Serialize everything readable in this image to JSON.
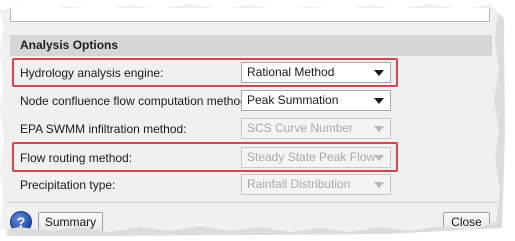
{
  "section": {
    "title": "Analysis Options"
  },
  "rows": [
    {
      "label": "Hydrology analysis engine:",
      "value": "Rational Method",
      "enabled": true,
      "highlighted": true
    },
    {
      "label": "Node confluence flow computation method:",
      "value": "Peak Summation",
      "enabled": true,
      "highlighted": false
    },
    {
      "label": "EPA SWMM infiltration method:",
      "value": "SCS Curve Number",
      "enabled": false,
      "highlighted": false
    },
    {
      "label": "Flow routing method:",
      "value": "Steady State Peak Flow",
      "enabled": false,
      "highlighted": true
    },
    {
      "label": "Precipitation type:",
      "value": "Rainfall Distribution",
      "enabled": false,
      "highlighted": false
    }
  ],
  "footer": {
    "help_icon": "question-mark-icon",
    "help_label": "?",
    "summary_label": "Summary",
    "close_label": "Close"
  },
  "colors": {
    "highlight": "#d9454f",
    "section_header": "#d6d6d6",
    "disabled_text": "#a8a8a8"
  }
}
